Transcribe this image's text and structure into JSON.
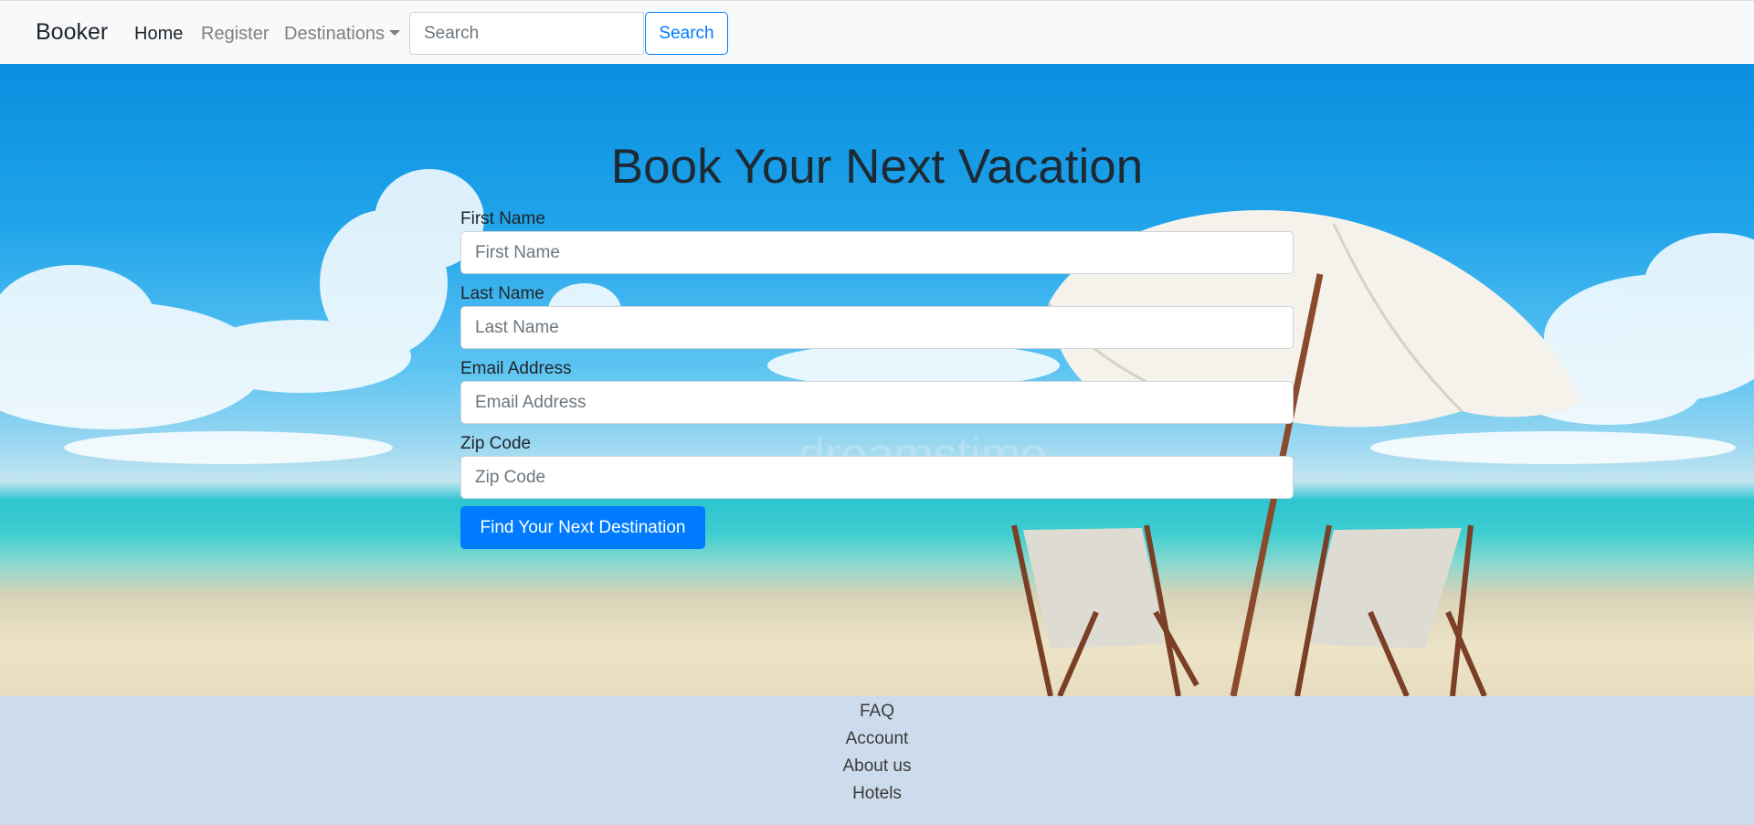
{
  "navbar": {
    "brand": "Booker",
    "links": {
      "home": "Home",
      "register": "Register",
      "destinations": "Destinations"
    },
    "search": {
      "placeholder": "Search",
      "button": "Search"
    }
  },
  "hero": {
    "title": "Book Your Next Vacation",
    "watermark": "dreamstime",
    "fields": {
      "first_name": {
        "label": "First Name",
        "placeholder": "First Name"
      },
      "last_name": {
        "label": "Last Name",
        "placeholder": "Last Name"
      },
      "email": {
        "label": "Email Address",
        "placeholder": "Email Address"
      },
      "zip": {
        "label": "Zip Code",
        "placeholder": "Zip Code"
      }
    },
    "submit": "Find Your Next Destination"
  },
  "footer": {
    "links": [
      "FAQ",
      "Account",
      "About us",
      "Hotels"
    ]
  },
  "colors": {
    "primary": "#007bff",
    "navbar_bg": "#f8f9fa",
    "footer_bg": "#cddcec"
  }
}
